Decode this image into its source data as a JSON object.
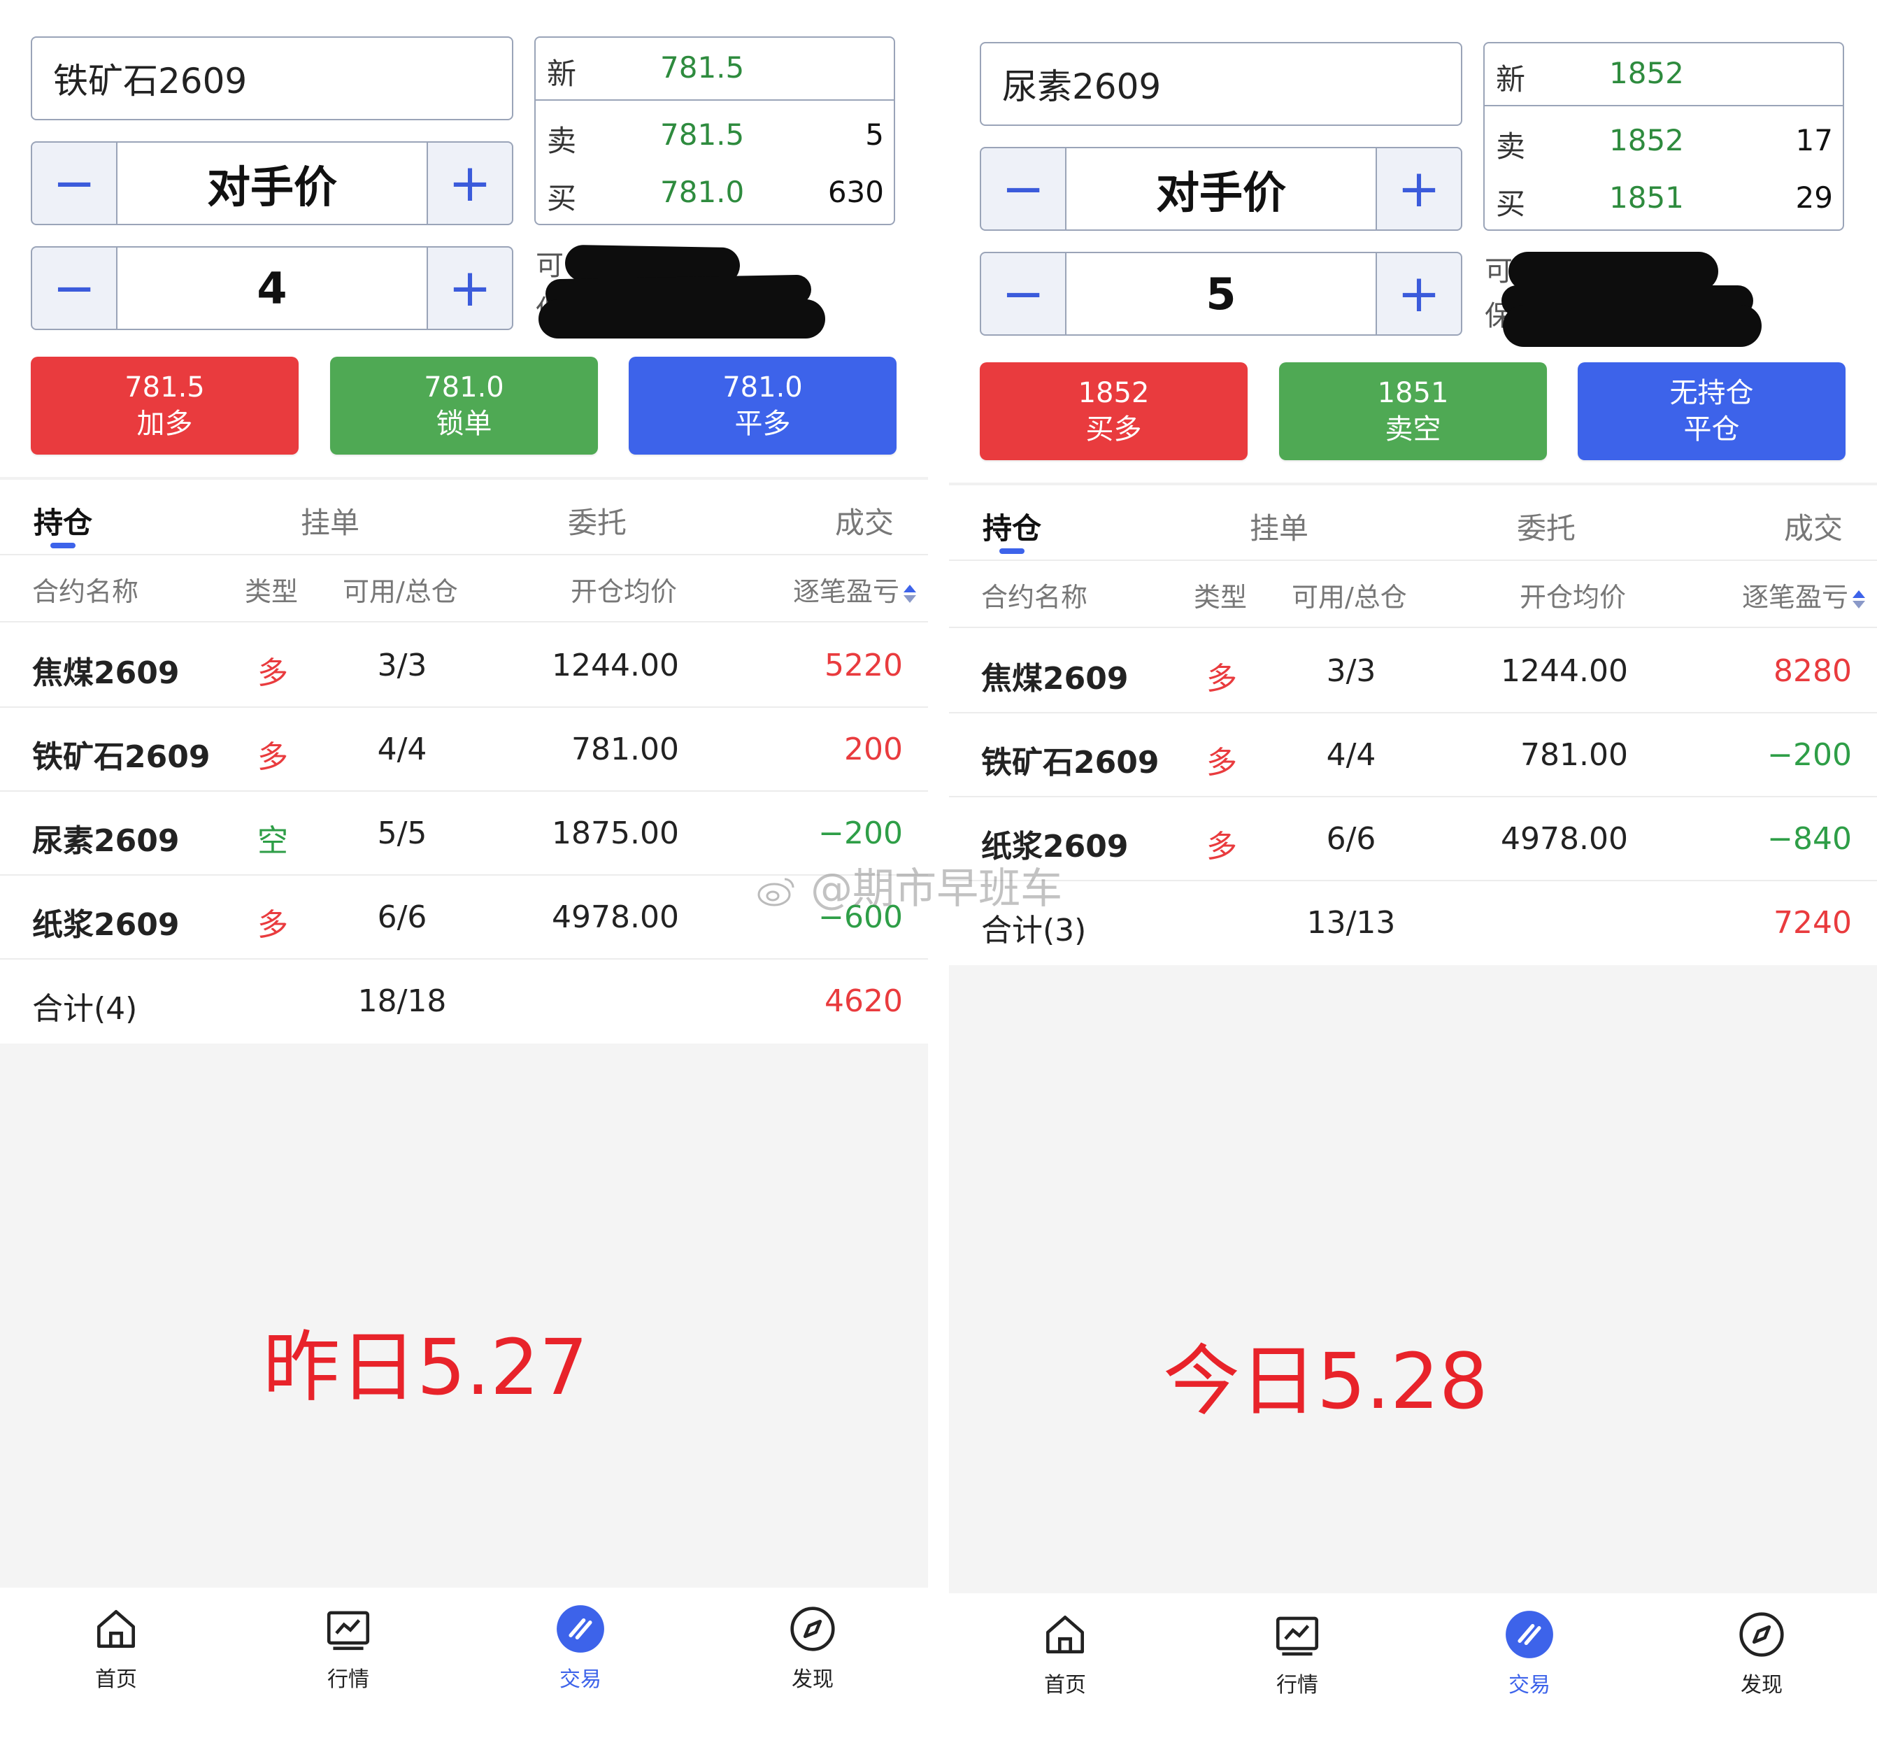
{
  "left": {
    "symbol": "铁矿石2609",
    "price_mode": "对手价",
    "quantity": "4",
    "quote": {
      "last_label": "新",
      "last": "781.5",
      "ask_label": "卖",
      "ask": "781.5",
      "ask_vol": "5",
      "bid_label": "买",
      "bid": "781.0",
      "bid_vol": "630"
    },
    "avail_label_1": "可",
    "avail_label_2": "保",
    "buttons": [
      {
        "price": "781.5",
        "action": "加多"
      },
      {
        "price": "781.0",
        "action": "锁单"
      },
      {
        "price": "781.0",
        "action": "平多"
      }
    ],
    "tabs": [
      "持仓",
      "挂单",
      "委托",
      "成交"
    ],
    "headers": {
      "name": "合约名称",
      "type": "类型",
      "qty": "可用/总仓",
      "avg": "开仓均价",
      "pnl": "逐笔盈亏"
    },
    "rows": [
      {
        "name": "焦煤2609",
        "type": "多",
        "qty": "3/3",
        "avg": "1244.00",
        "pnl": "5220"
      },
      {
        "name": "铁矿石2609",
        "type": "多",
        "qty": "4/4",
        "avg": "781.00",
        "pnl": "200"
      },
      {
        "name": "尿素2609",
        "type": "空",
        "qty": "5/5",
        "avg": "1875.00",
        "pnl": "−200"
      },
      {
        "name": "纸浆2609",
        "type": "多",
        "qty": "6/6",
        "avg": "4978.00",
        "pnl": "−600"
      }
    ],
    "total": {
      "label": "合计(4)",
      "qty": "18/18",
      "pnl": "4620"
    },
    "annotation": "昨日5.27"
  },
  "right": {
    "symbol": "尿素2609",
    "price_mode": "对手价",
    "quantity": "5",
    "quote": {
      "last_label": "新",
      "last": "1852",
      "ask_label": "卖",
      "ask": "1852",
      "ask_vol": "17",
      "bid_label": "买",
      "bid": "1851",
      "bid_vol": "29"
    },
    "avail_label_1": "可",
    "avail_label_2": "保",
    "buttons": [
      {
        "price": "1852",
        "action": "买多"
      },
      {
        "price": "1851",
        "action": "卖空"
      },
      {
        "price": "无持仓",
        "action": "平仓"
      }
    ],
    "tabs": [
      "持仓",
      "挂单",
      "委托",
      "成交"
    ],
    "headers": {
      "name": "合约名称",
      "type": "类型",
      "qty": "可用/总仓",
      "avg": "开仓均价",
      "pnl": "逐笔盈亏"
    },
    "rows": [
      {
        "name": "焦煤2609",
        "type": "多",
        "qty": "3/3",
        "avg": "1244.00",
        "pnl": "8280"
      },
      {
        "name": "铁矿石2609",
        "type": "多",
        "qty": "4/4",
        "avg": "781.00",
        "pnl": "−200"
      },
      {
        "name": "纸浆2609",
        "type": "多",
        "qty": "6/6",
        "avg": "4978.00",
        "pnl": "−840"
      }
    ],
    "total": {
      "label": "合计(3)",
      "qty": "13/13",
      "pnl": "7240"
    },
    "annotation": "今日5.28"
  },
  "nav": [
    "首页",
    "行情",
    "交易",
    "发现"
  ],
  "watermark": "@期市早班车",
  "colors": {
    "red": "#e93b3e",
    "green": "#4fa954",
    "blue": "#3d63ea",
    "profit": "#e93b3e",
    "loss": "#2e9e47"
  },
  "icons": [
    "minus-icon",
    "plus-icon",
    "sort-icon",
    "home-icon",
    "chart-icon",
    "trade-icon",
    "compass-icon",
    "weibo-icon"
  ]
}
